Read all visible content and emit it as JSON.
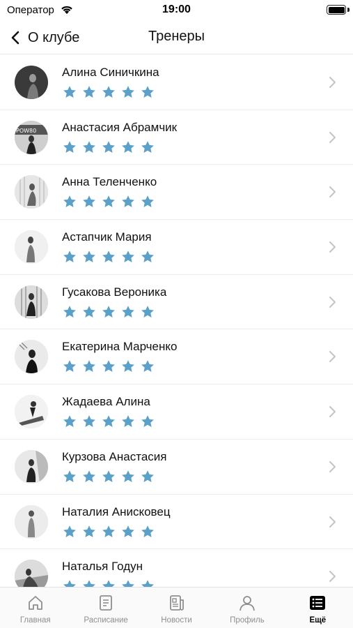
{
  "status_bar": {
    "carrier": "Оператор",
    "time": "19:00"
  },
  "nav": {
    "back_label": "О клубе",
    "title": "Тренеры"
  },
  "colors": {
    "star": "#5aa0c8",
    "chevron": "#c4c4c8",
    "tab_inactive": "#8e8e8e",
    "tab_active": "#000000"
  },
  "trainers": [
    {
      "name": "Алина Синичкина",
      "rating": 5
    },
    {
      "name": "Анастасия Абрамчик",
      "rating": 5
    },
    {
      "name": "Анна Теленченко",
      "rating": 5
    },
    {
      "name": "Астапчик Мария",
      "rating": 5
    },
    {
      "name": "Гусакова Вероника",
      "rating": 5
    },
    {
      "name": "Екатерина Марченко",
      "rating": 5
    },
    {
      "name": "Жадаева Алина",
      "rating": 5
    },
    {
      "name": "Курзова Анастасия",
      "rating": 5
    },
    {
      "name": "Наталия Анисковец",
      "rating": 5
    },
    {
      "name": "Наталья Годун",
      "rating": 5
    }
  ],
  "tabs": [
    {
      "label": "Главная",
      "icon": "home-icon",
      "active": false
    },
    {
      "label": "Расписание",
      "icon": "schedule-icon",
      "active": false
    },
    {
      "label": "Новости",
      "icon": "news-icon",
      "active": false
    },
    {
      "label": "Профиль",
      "icon": "profile-icon",
      "active": false
    },
    {
      "label": "Ещё",
      "icon": "more-icon",
      "active": true
    }
  ]
}
